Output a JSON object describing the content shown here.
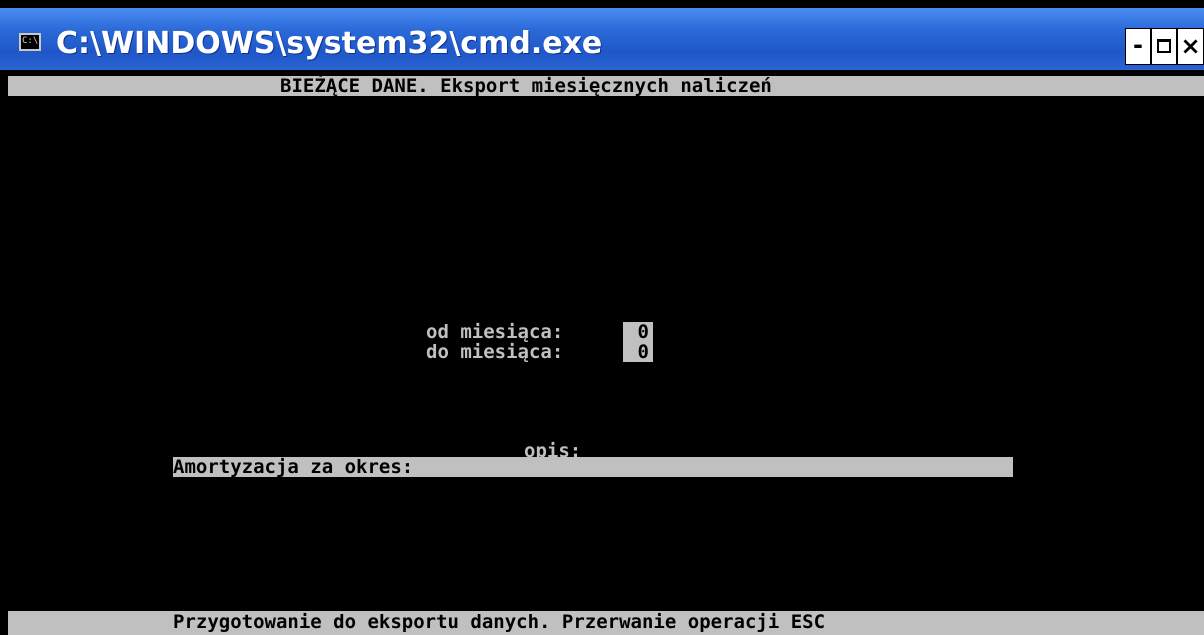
{
  "window": {
    "title": "C:\\WINDOWS\\system32\\cmd.exe",
    "icon": "cmd-icon",
    "icon_glyph": "C:\\",
    "controls": {
      "minimize": "-",
      "close": "×"
    }
  },
  "console": {
    "header": "BIEŻĄCE DANE. Eksport miesięcznych naliczeń",
    "from_month_label": "od miesiąca:",
    "from_month_value": "0",
    "to_month_label": "do miesiąca:",
    "to_month_value": "0",
    "description_label": "opis:",
    "description_value": "Amortyzacja za okres:",
    "status": "Przygotowanie do eksportu danych. Przerwanie operacji ESC"
  },
  "colors": {
    "titlebar": "#2b6ad8",
    "console_background": "#000000",
    "highlight": "#c0c0c0"
  }
}
